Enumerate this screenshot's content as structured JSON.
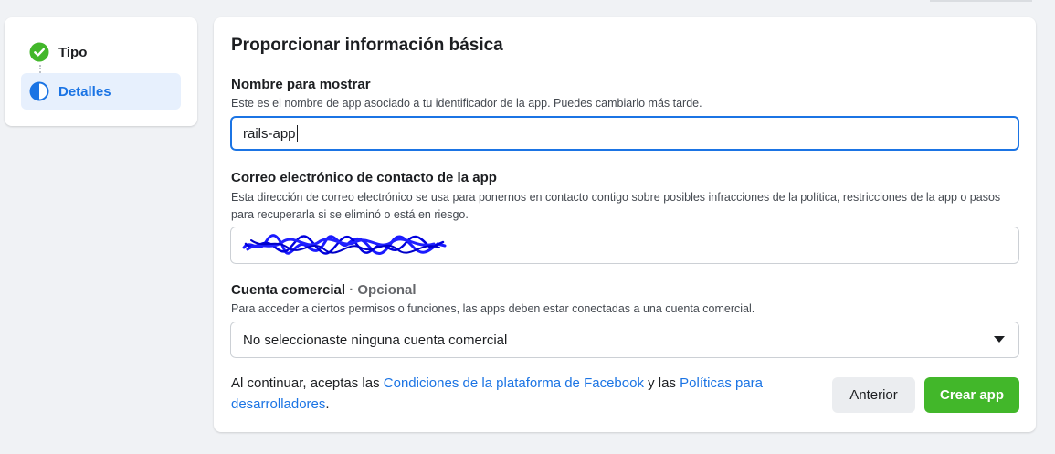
{
  "stepper": {
    "steps": [
      {
        "label": "Tipo",
        "status": "complete",
        "icon": "check-circle-icon"
      },
      {
        "label": "Detalles",
        "status": "current",
        "icon": "half-circle-icon"
      }
    ]
  },
  "form": {
    "title": "Proporcionar información básica",
    "display_name": {
      "label": "Nombre para mostrar",
      "help": "Este es el nombre de app asociado a tu identificador de la app. Puedes cambiarlo más tarde.",
      "value": "rails-app"
    },
    "contact_email": {
      "label": "Correo electrónico de contacto de la app",
      "help": "Esta dirección de correo electrónico se usa para ponernos en contacto contigo sobre posibles infracciones de la política, restricciones de la app o pasos para recuperarla si se eliminó o está en riesgo.",
      "value_redacted": true
    },
    "business_account": {
      "label": "Cuenta comercial",
      "optional": "· Opcional",
      "help": "Para acceder a ciertos permisos o funciones, las apps deben estar conectadas a una cuenta comercial.",
      "selected": "No seleccionaste ninguna cuenta comercial"
    },
    "terms": {
      "prefix": "Al continuar, aceptas las ",
      "link1": "Condiciones de la plataforma de Facebook",
      "middle": " y las ",
      "link2": "Políticas para desarrolladores",
      "suffix": "."
    },
    "buttons": {
      "back": "Anterior",
      "create": "Crear app"
    }
  },
  "colors": {
    "accent": "#1b74e4",
    "primary_button": "#42b72a",
    "step_complete": "#42b72a",
    "background": "#f0f2f5"
  }
}
